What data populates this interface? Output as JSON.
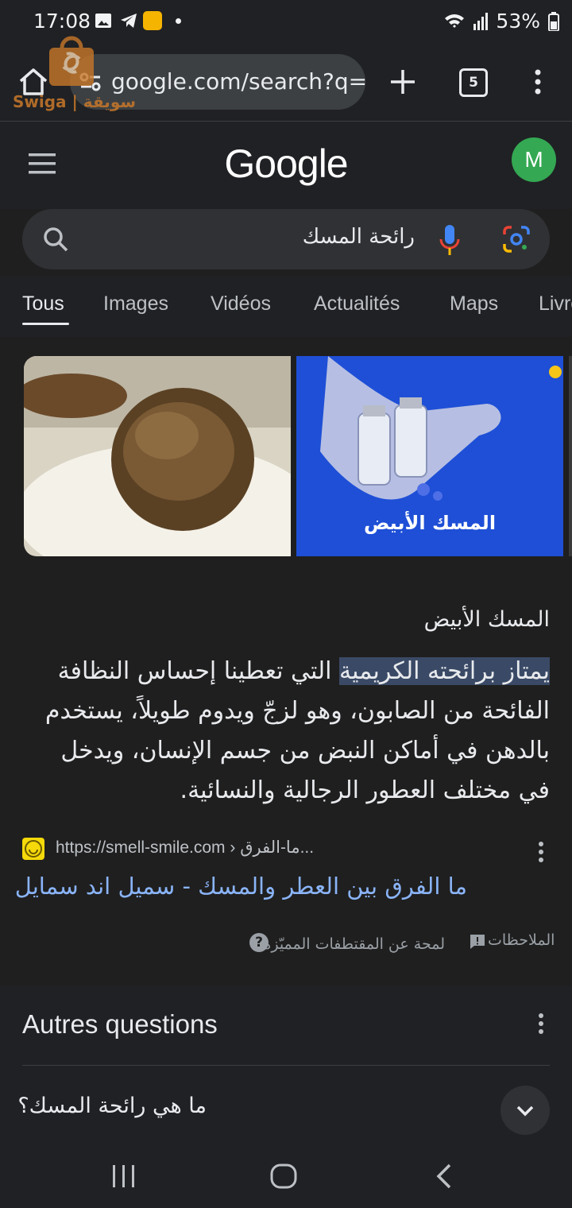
{
  "status_bar": {
    "time": "17:08",
    "battery": "53%"
  },
  "browser": {
    "url": "google.com/search?q=",
    "tab_count": "5"
  },
  "watermark": {
    "text": "Swiga | سويقة"
  },
  "google": {
    "logo": "Google",
    "avatar_letter": "M"
  },
  "search": {
    "query": "رائحة المسك"
  },
  "tabs": [
    {
      "label": "Tous",
      "active": true
    },
    {
      "label": "Images"
    },
    {
      "label": "Vidéos"
    },
    {
      "label": "Actualités"
    },
    {
      "label": "Maps"
    },
    {
      "label": "Livres"
    }
  ],
  "images": {
    "caption_2": "المسك الأبيض"
  },
  "featured_snippet": {
    "title": "المسك الأبيض",
    "highlight": "يمتاز برائحته الكريمية",
    "body": " التي تعطينا إحساس النظافة الفائحة من الصابون، وهو لزجّ ويدوم طويلاً، يستخدم بالدهن في أماكن النبض من جسم الإنسان، ويدخل في مختلف العطور الرجالية والنسائية.",
    "source_url": "https://smell-smile.com › ما-الفرق...",
    "result_title": "ما الفرق بين العطر والمسك - سميل اند سمايل",
    "about": "لمحة عن المقتطفات المميّزة",
    "feedback": "الملاحظات"
  },
  "people_also_ask": {
    "title": "Autres questions",
    "question_1": "ما هي رائحة المسك؟"
  },
  "colors": {
    "link": "#8ab4f8",
    "avatar": "#34a853",
    "background": "#1f1f1f"
  }
}
